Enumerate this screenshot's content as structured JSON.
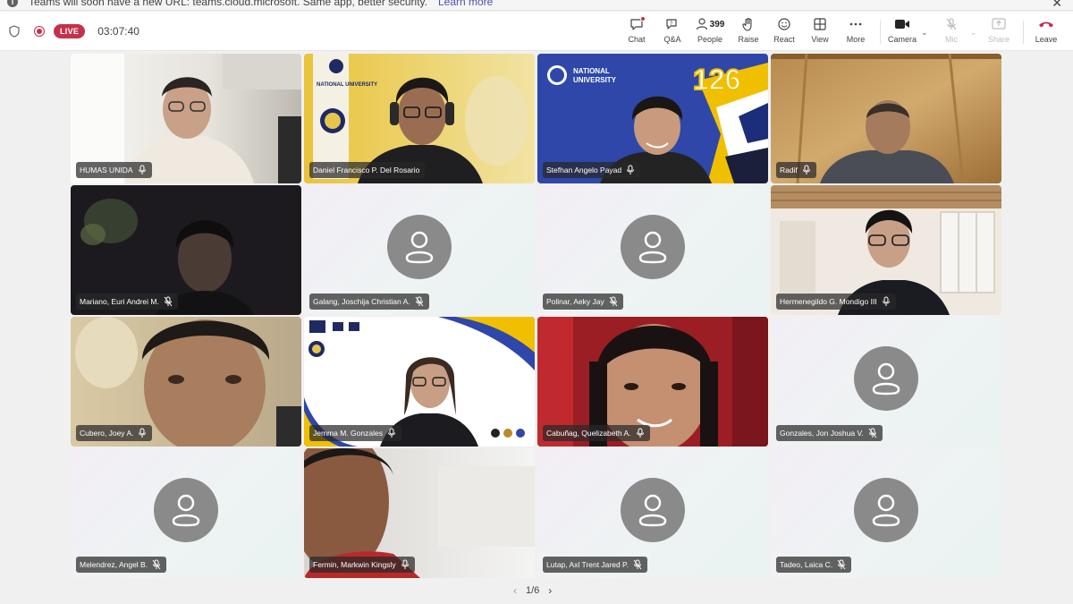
{
  "banner": {
    "text": "Teams will soon have a new URL: teams.cloud.microsoft. Same app, better security.",
    "link": "Learn more"
  },
  "meeting": {
    "live_label": "LIVE",
    "elapsed": "03:07:40"
  },
  "toolbar": {
    "chat": "Chat",
    "qa": "Q&A",
    "people": "People",
    "people_count": "399",
    "raise": "Raise",
    "react": "React",
    "view": "View",
    "more": "More",
    "camera": "Camera",
    "mic": "Mic",
    "share": "Share",
    "leave": "Leave"
  },
  "participants": [
    {
      "name": "HUMAS UNIDA",
      "video": "video-1"
    },
    {
      "name": "Daniel Francisco P. Del Rosario",
      "video": "video-2"
    },
    {
      "name": "Stefhan Angelo Payad",
      "video": "video-3"
    },
    {
      "name": "Radif",
      "video": "video-4"
    },
    {
      "name": "Mariano, Euri Andrei M.",
      "video": "video-5"
    },
    {
      "name": "Galang, Joschija Christian A.",
      "video": null
    },
    {
      "name": "Polinar, Aeky Jay",
      "video": null
    },
    {
      "name": "Hermenegildo G. Mondigo III",
      "video": "video-8"
    },
    {
      "name": "Cubero, Joey A.",
      "video": "video-9"
    },
    {
      "name": "Jemma M. Gonzales",
      "video": "video-10"
    },
    {
      "name": "Cabuñag, Quelizabeth A.",
      "video": "video-11"
    },
    {
      "name": "Gonzales, Jon Joshua V.",
      "video": null
    },
    {
      "name": "Melendrez, Angel B.",
      "video": null
    },
    {
      "name": "Fermin, Markwin Kingsly",
      "video": "video-14"
    },
    {
      "name": "Lutap, Axl Trent Jared P.",
      "video": null
    },
    {
      "name": "Tadeo, Laica C.",
      "video": null
    }
  ],
  "tile_logos": {
    "national_university": "NATIONAL UNIVERSITY",
    "anniversary": "126"
  },
  "pagination": {
    "label": "1/6"
  }
}
